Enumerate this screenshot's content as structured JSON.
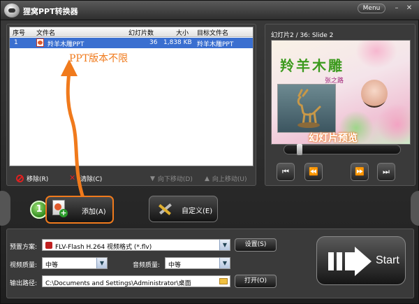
{
  "app": {
    "title": "狸窝PPT转换器",
    "menu_label": "Menu",
    "minimize": "–",
    "close": "✕"
  },
  "list": {
    "headers": [
      "序号",
      "文件名",
      "幻灯片数",
      "大小",
      "目标文件名"
    ],
    "rows": [
      {
        "index": "1",
        "filename": "羚羊木雕PPT",
        "slides": "36",
        "size": "1,838 KB",
        "target": "羚羊木雕PPT"
      }
    ]
  },
  "annotation": {
    "ppt_note": "PPT版本不限",
    "preview_note": "幻灯片预览"
  },
  "actions": {
    "remove": "移除(R)",
    "clear": "清除(C)",
    "move_down": "向下移动(D)",
    "move_up": "向上移动(U)"
  },
  "toolbar": {
    "step_number": "1",
    "add": "添加(A)",
    "custom": "自定义(E)"
  },
  "preview": {
    "header": "幻灯片2 / 36: Slide 2",
    "slide_title": "羚羊木雕",
    "slide_subtitle": "张之路",
    "controls": [
      "⏮",
      "⏪",
      "⏩",
      "⏭"
    ]
  },
  "settings": {
    "preset_label": "预置方案:",
    "preset_value": "FLV-Flash H.264 视频格式 (*.flv)",
    "preset_button": "设置(S)",
    "video_quality_label": "视频质量:",
    "video_quality_value": "中等",
    "audio_quality_label": "音频质量:",
    "audio_quality_value": "中等",
    "output_label": "输出路径:",
    "output_value": "C:\\Documents and Settings\\Administrator\\桌面",
    "open_button": "打开(O)"
  },
  "start": {
    "label": "Start"
  }
}
